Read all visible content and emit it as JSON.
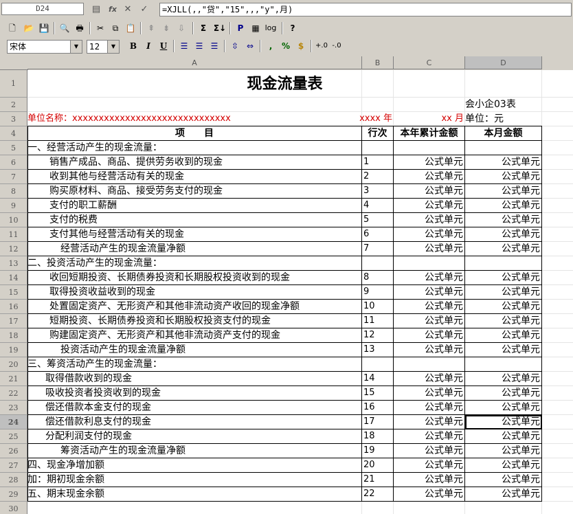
{
  "formula_bar": {
    "cell_ref": "D24",
    "fx": "fx",
    "formula": "=XJLL(,,\"贷\",\"15\",,,\"y\",月)"
  },
  "toolbar": {
    "print_label": "P",
    "log_label": "log",
    "help_label": "?"
  },
  "format_bar": {
    "font_name": "宋体",
    "font_size": "12",
    "bold": "B",
    "italic": "I",
    "underline": "U",
    "comma": ",",
    "percent": "%",
    "currency": "$"
  },
  "columns": [
    "A",
    "B",
    "C",
    "D"
  ],
  "active_col": "D",
  "active_row": 24,
  "row_numbers": [
    "1",
    "2",
    "3",
    "4",
    "5",
    "6",
    "7",
    "8",
    "9",
    "10",
    "11",
    "12",
    "13",
    "14",
    "15",
    "16",
    "17",
    "18",
    "19",
    "20",
    "21",
    "22",
    "23",
    "24",
    "25",
    "26",
    "27",
    "28",
    "29",
    "30"
  ],
  "sheet": {
    "title": "现金流量表",
    "form_code": "会小企03表",
    "unit_name_label": "单位名称：xxxxxxxxxxxxxxxxxxxxxxxxxxxxxx",
    "year_label": "xxxx 年",
    "month_label": "xx 月",
    "unit_label": "单位：元",
    "headers": [
      "项　　目",
      "行次",
      "本年累计金额",
      "本月金额"
    ],
    "formula_cell": "公式单元",
    "rows": [
      {
        "label": "一、经营活动产生的现金流量：",
        "indent": 0,
        "line": ""
      },
      {
        "label": "销售产成品、商品、提供劳务收到的现金",
        "indent": 2,
        "line": "1"
      },
      {
        "label": "收到其他与经营活动有关的现金",
        "indent": 2,
        "line": "2"
      },
      {
        "label": "购买原材料、商品、接受劳务支付的现金",
        "indent": 2,
        "line": "3"
      },
      {
        "label": "支付的职工薪酬",
        "indent": 2,
        "line": "4"
      },
      {
        "label": "支付的税费",
        "indent": 2,
        "line": "5"
      },
      {
        "label": "支付其他与经营活动有关的现金",
        "indent": 2,
        "line": "6"
      },
      {
        "label": "经营活动产生的现金流量净额",
        "indent": 3,
        "line": "7"
      },
      {
        "label": "二、投资活动产生的现金流量：",
        "indent": 0,
        "line": ""
      },
      {
        "label": "收回短期投资、长期债券投资和长期股权投资收到的现金",
        "indent": 2,
        "line": "8"
      },
      {
        "label": "取得投资收益收到的现金",
        "indent": 2,
        "line": "9"
      },
      {
        "label": "处置固定资产、无形资产和其他非流动资产收回的现金净额",
        "indent": 2,
        "line": "10"
      },
      {
        "label": "短期投资、长期债券投资和长期股权投资支付的现金",
        "indent": 2,
        "line": "11"
      },
      {
        "label": "购建固定资产、无形资产和其他非流动资产支付的现金",
        "indent": 2,
        "line": "12"
      },
      {
        "label": "投资活动产生的现金流量净额",
        "indent": 3,
        "line": "13"
      },
      {
        "label": "三、筹资活动产生的现金流量：",
        "indent": 0,
        "line": ""
      },
      {
        "label": "取得借款收到的现金",
        "indent": 1,
        "line": "14"
      },
      {
        "label": "吸收投资者投资收到的现金",
        "indent": 1,
        "line": "15"
      },
      {
        "label": "偿还借款本金支付的现金",
        "indent": 1,
        "line": "16"
      },
      {
        "label": "偿还借款利息支付的现金",
        "indent": 1,
        "line": "17"
      },
      {
        "label": "分配利润支付的现金",
        "indent": 1,
        "line": "18"
      },
      {
        "label": "筹资活动产生的现金流量净额",
        "indent": 3,
        "line": "19"
      },
      {
        "label": "四、现金净增加额",
        "indent": 0,
        "line": "20"
      },
      {
        "label": "加：期初现金余额",
        "indent": 0,
        "line": "21"
      },
      {
        "label": "五、期末现金余额",
        "indent": 0,
        "line": "22"
      }
    ]
  }
}
